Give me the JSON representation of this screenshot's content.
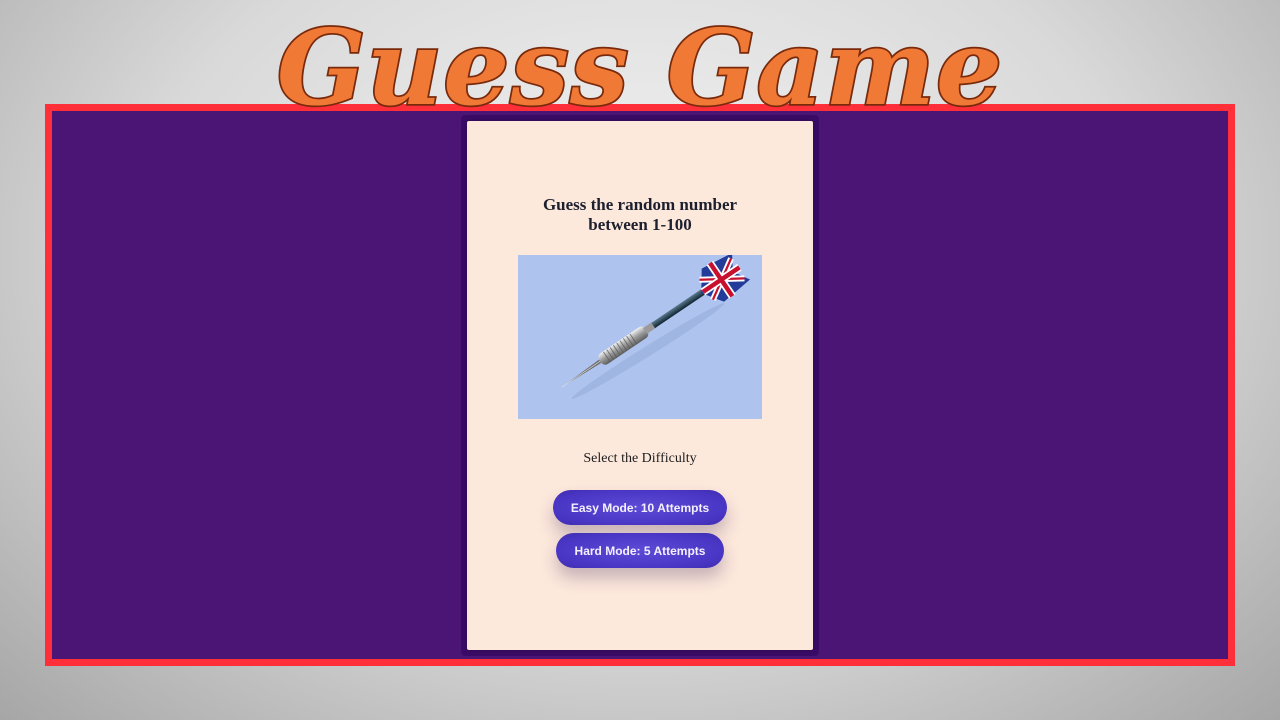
{
  "header": {
    "logo_text": "Guess Game"
  },
  "card": {
    "title_line1": "Guess the random number",
    "title_line2": "between 1-100",
    "image_alt": "dart-with-union-jack-flight",
    "subtitle": "Select the Difficulty"
  },
  "buttons": {
    "easy_label": "Easy Mode: 10 Attempts",
    "hard_label": "Hard Mode: 5 Attempts"
  },
  "colors": {
    "frame_border": "#ff2f39",
    "frame_background": "#4a1575",
    "card_background": "#fde8dc",
    "button_color": "#4a36c4",
    "logo_fill": "#f07a35",
    "logo_outline": "#7a2a0c"
  }
}
